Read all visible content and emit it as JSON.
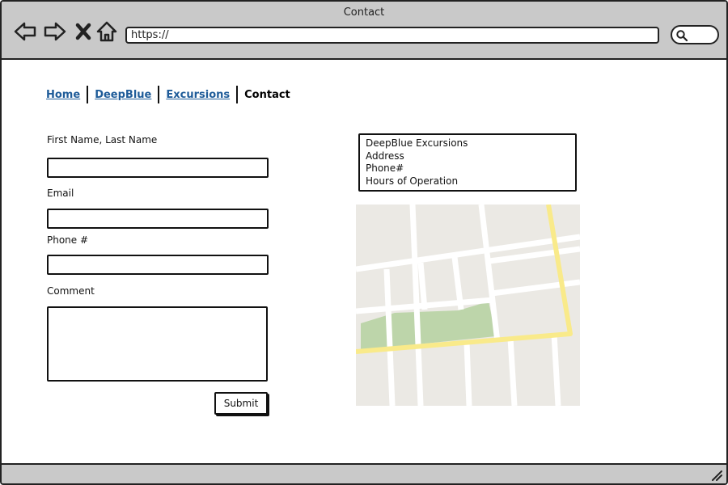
{
  "window": {
    "title": "Contact"
  },
  "toolbar": {
    "back_icon": "back-arrow-icon",
    "forward_icon": "forward-arrow-icon",
    "stop_icon": "close-icon",
    "home_icon": "home-icon",
    "search_icon": "search-icon"
  },
  "address_bar": {
    "value": "https://"
  },
  "breadcrumb": {
    "items": [
      {
        "label": "Home",
        "link": true
      },
      {
        "label": "DeepBlue",
        "link": true
      },
      {
        "label": "Excursions",
        "link": true
      },
      {
        "label": "Contact",
        "link": false
      }
    ],
    "link_color": "#1f5c99"
  },
  "form": {
    "name_label": "First Name, Last Name",
    "name_value": "",
    "email_label": "Email",
    "email_value": "",
    "phone_label": "Phone #",
    "phone_value": "",
    "comment_label": "Comment",
    "comment_value": "",
    "submit_label": "Submit"
  },
  "contact_info": {
    "lines": [
      "DeepBlue Excursions",
      "Address",
      "Phone#",
      "Hours of Operation"
    ]
  },
  "map": {
    "icon": "map-image",
    "colors": {
      "land": "#ebe9e4",
      "road": "#ffffff",
      "highway": "#f9ea8a",
      "park": "#bdd5aa"
    }
  }
}
